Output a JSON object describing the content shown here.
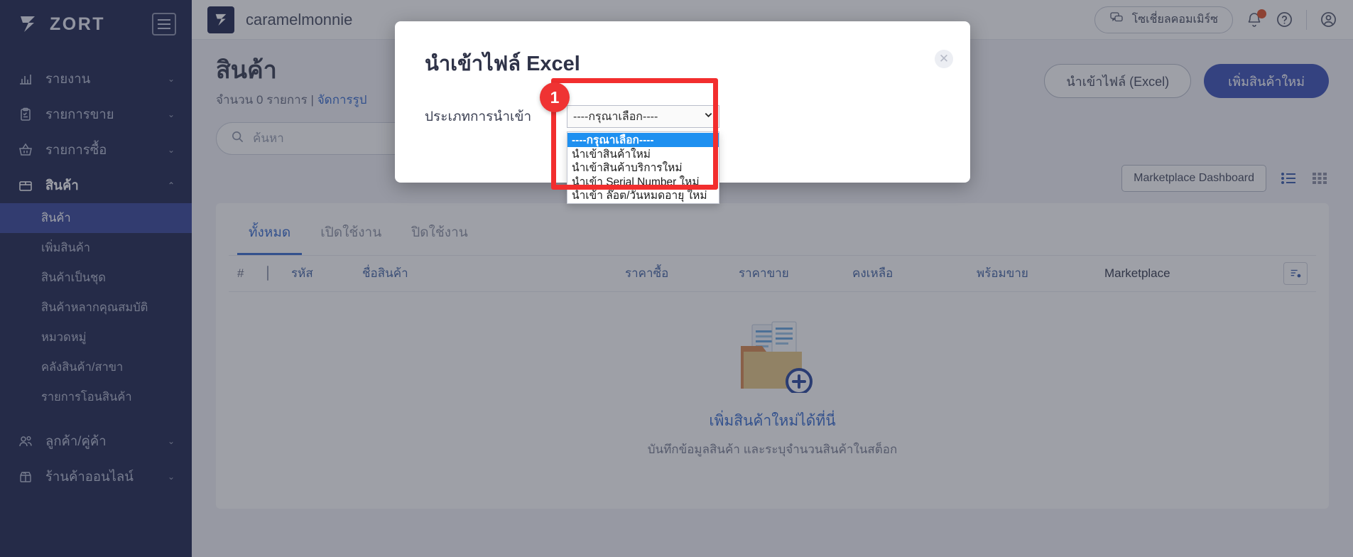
{
  "sidebar": {
    "brand": "ZORT",
    "menu_icon": "hamburger-icon",
    "items": [
      {
        "label": "รายงาน",
        "icon": "chart-bar-icon",
        "chevron": "⌄"
      },
      {
        "label": "รายการขาย",
        "icon": "clipboard-check-icon",
        "chevron": "⌄"
      },
      {
        "label": "รายการซื้อ",
        "icon": "basket-icon",
        "chevron": "⌄"
      },
      {
        "label": "สินค้า",
        "icon": "box-icon",
        "chevron": "⌃"
      }
    ],
    "product_subitems": [
      {
        "label": "สินค้า",
        "selected": true
      },
      {
        "label": "เพิ่มสินค้า",
        "selected": false
      },
      {
        "label": "สินค้าเป็นชุด",
        "selected": false
      },
      {
        "label": "สินค้าหลากคุณสมบัติ",
        "selected": false
      },
      {
        "label": "หมวดหมู่",
        "selected": false
      },
      {
        "label": "คลังสินค้า/สาขา",
        "selected": false
      },
      {
        "label": "รายการโอนสินค้า",
        "selected": false
      }
    ],
    "bottom_items": [
      {
        "label": "ลูกค้า/คู่ค้า",
        "icon": "users-icon",
        "chevron": "⌄"
      },
      {
        "label": "ร้านค้าออนไลน์",
        "icon": "store-gift-icon",
        "chevron": "⌄"
      }
    ]
  },
  "topbar": {
    "account_name": "caramelmonnie",
    "social_commerce_label": "โซเชี่ยลคอมเมิร์ซ",
    "social_icon": "chat-bubbles-icon",
    "bell_icon": "bell-icon",
    "help_icon": "question-circle-icon",
    "user_icon": "user-avatar-icon",
    "has_notification": true
  },
  "page": {
    "title": "สินค้า",
    "count_text": "จำนวน 0 รายการ",
    "separator": "|",
    "manage_link": "จัดการรูป",
    "import_button": "นำเข้าไฟล์ (Excel)",
    "add_button": "เพิ่มสินค้าใหม่",
    "search_placeholder": "ค้นหา",
    "search_icon": "search-icon",
    "marketplace_dashboard": "Marketplace Dashboard",
    "list_view_icon": "list-view-icon",
    "grid_view_icon": "grid-view-icon"
  },
  "tabs": [
    {
      "label": "ทั้งหมด",
      "active": true
    },
    {
      "label": "เปิดใช้งาน",
      "active": false
    },
    {
      "label": "ปิดใช้งาน",
      "active": false
    }
  ],
  "table": {
    "hash": "#",
    "columns": [
      "รหัส",
      "ชื่อสินค้า",
      "ราคาซื้อ",
      "ราคาขาย",
      "คงเหลือ",
      "พร้อมขาย",
      "Marketplace"
    ],
    "sort_icon": "sort-settings-icon",
    "rows": []
  },
  "empty_state": {
    "illustration": "folder-documents-plus-icon",
    "title": "เพิ่มสินค้าใหม่ได้ที่นี่",
    "subtitle": "บันทึกข้อมูลสินค้า และระบุจำนวนสินค้าในสต็อก"
  },
  "modal": {
    "title": "นำเข้าไฟล์ Excel",
    "close_icon": "close-icon",
    "field_label": "ประเภทการนำเข้า",
    "select_value": "----กรุณาเลือก----",
    "chevron_icon": "chevron-down-icon",
    "options": [
      {
        "label": "----กรุณาเลือก----",
        "highlighted": true
      },
      {
        "label": "นำเข้าสินค้าใหม่",
        "highlighted": false
      },
      {
        "label": "นำเข้าสินค้าบริการใหม่",
        "highlighted": false
      },
      {
        "label": "นำเข้า Serial Number ใหม่",
        "highlighted": false
      },
      {
        "label": "นำเข้า ล๊อต/วันหมดอายุ ใหม่",
        "highlighted": false
      }
    ]
  },
  "annotation": {
    "number": "1",
    "color": "#ef3333"
  },
  "colors": {
    "sidebar_bg": "#232a52",
    "sidebar_selected": "#3b4a9c",
    "primary": "#3e55b8",
    "link": "#3c6fd0",
    "highlight": "#1e90f0",
    "annotation": "#ef3333"
  }
}
